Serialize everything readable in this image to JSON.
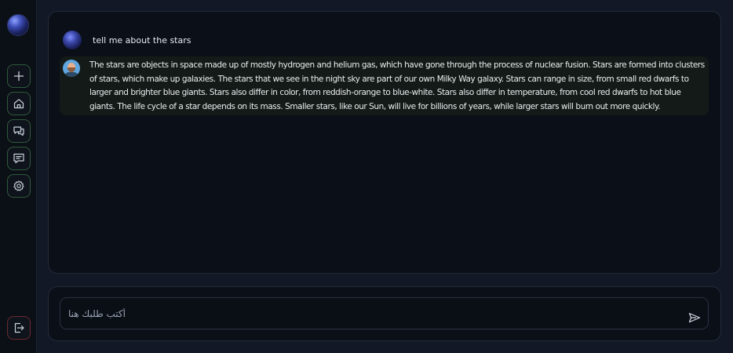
{
  "sidebar": {
    "profile_avatar": "profile-avatar",
    "items": [
      {
        "name": "new-chat",
        "icon": "plus-icon"
      },
      {
        "name": "home",
        "icon": "home-icon"
      },
      {
        "name": "chats",
        "icon": "chats-icon"
      },
      {
        "name": "messages",
        "icon": "message-icon"
      },
      {
        "name": "settings",
        "icon": "gear-icon"
      }
    ],
    "logout_icon": "logout-icon"
  },
  "chat": {
    "messages": [
      {
        "role": "user",
        "text": "tell me about the stars"
      },
      {
        "role": "assistant",
        "text": "The stars are objects in space made up of mostly hydrogen and helium gas, which have gone through the process of nuclear fusion. Stars are formed into clusters of stars, which make up galaxies. The stars that we see in the night sky are part of our own Milky Way galaxy. Stars can range in size, from small red dwarfs to larger and brighter blue giants. Stars also differ in color, from reddish-orange to blue-white. Stars also differ in temperature, from cool red dwarfs to hot blue giants. The life cycle of a star depends on its mass. Smaller stars, like our Sun, will live for billions of years, while larger stars will burn out more quickly."
      }
    ]
  },
  "composer": {
    "placeholder": "أكتب طلبك هنا",
    "value": "",
    "send_icon": "send-icon"
  },
  "colors": {
    "background": "#121826",
    "sidebar": "#0b0f16",
    "panel": "#0b0f17",
    "assistant_bubble": "#141a17",
    "icon_border_green": "#2f5a3a",
    "logout_border_red": "#6a2a31"
  }
}
